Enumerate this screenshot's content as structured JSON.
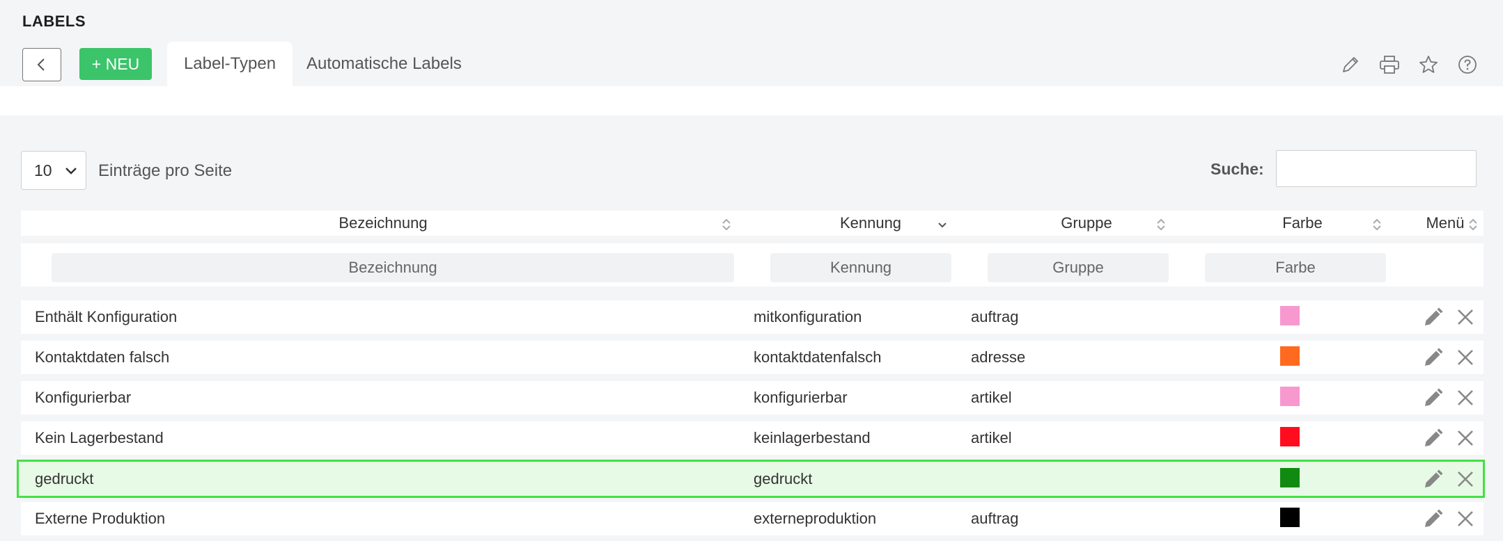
{
  "header": {
    "title": "LABELS",
    "new_button": "+ NEU",
    "tabs": [
      "Label-Typen",
      "Automatische Labels"
    ],
    "tools": [
      "pencil-icon",
      "print-icon",
      "star-icon",
      "help-icon"
    ]
  },
  "controls": {
    "page_size": "10",
    "page_size_label": "Einträge pro Seite",
    "search_label": "Suche:",
    "search_value": ""
  },
  "table": {
    "columns": [
      "Bezeichnung",
      "Kennung",
      "Gruppe",
      "Farbe",
      "Menü"
    ],
    "filters": [
      "Bezeichnung",
      "Kennung",
      "Gruppe",
      "Farbe"
    ],
    "rows": [
      {
        "bezeichnung": "Enthält Konfiguration",
        "kennung": "mitkonfiguration",
        "gruppe": "auftrag",
        "farbe": "#f799cf"
      },
      {
        "bezeichnung": "Kontaktdaten falsch",
        "kennung": "kontaktdatenfalsch",
        "gruppe": "adresse",
        "farbe": "#ff6a1f"
      },
      {
        "bezeichnung": "Konfigurierbar",
        "kennung": "konfigurierbar",
        "gruppe": "artikel",
        "farbe": "#f799cf"
      },
      {
        "bezeichnung": "Kein Lagerbestand",
        "kennung": "keinlagerbestand",
        "gruppe": "artikel",
        "farbe": "#ff0d1f"
      },
      {
        "bezeichnung": "gedruckt",
        "kennung": "gedruckt",
        "gruppe": "",
        "farbe": "#118a11"
      },
      {
        "bezeichnung": "Externe Produktion",
        "kennung": "externeproduktion",
        "gruppe": "auftrag",
        "farbe": "#000000"
      }
    ]
  },
  "colors": {
    "new_button": "#3bc46a",
    "selected_row_bg": "#e6fae6",
    "selected_row_border": "#44e044"
  }
}
